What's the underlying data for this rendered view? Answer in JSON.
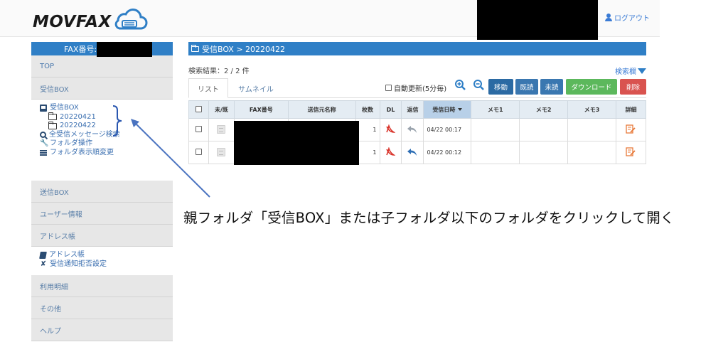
{
  "header": {
    "logo_text": "MOVFAX",
    "logout_label": "ログアウト"
  },
  "sidebar": {
    "fax_number_label": "FAX番号:",
    "nav_top": "TOP",
    "nav_inbox": "受信BOX",
    "inbox_panel": {
      "root_label": "受信BOX",
      "folders": [
        "20220421",
        "20220422"
      ],
      "search_all": "全受信メッセージ検索",
      "folder_ops": "フォルダ操作",
      "folder_order": "フォルダ表示順変更"
    },
    "nav_outbox": "送信BOX",
    "nav_userinfo": "ユーザー情報",
    "nav_addressbook": "アドレス帳",
    "address_panel": {
      "addressbook": "アドレス帳",
      "reject": "受信通知拒否設定"
    },
    "nav_usage": "利用明細",
    "nav_other": "その他",
    "nav_help": "ヘルプ"
  },
  "main": {
    "breadcrumb": "受信BOX > 20220422",
    "results": "検索結果：2 / 2 件",
    "search_toggle": "検索欄",
    "tabs": [
      "リスト",
      "サムネイル"
    ],
    "auto_update": "自動更新(5分毎)",
    "buttons": {
      "move": "移動",
      "read": "既読",
      "unread": "未読",
      "download": "ダウンロード",
      "delete": "削除"
    },
    "table": {
      "headers": [
        "",
        "未/既",
        "FAX番号",
        "送信元名称",
        "枚数",
        "DL",
        "返信",
        "受信日時",
        "メモ1",
        "メモ2",
        "メモ3",
        "詳細"
      ],
      "rows": [
        {
          "pages": "1",
          "received": "04/22 00:17"
        },
        {
          "pages": "1",
          "received": "04/22 00:12"
        }
      ]
    }
  },
  "annotation": {
    "caption": "親フォルダ「受信BOX」または子フォルダ以下のフォルダをクリックして開く"
  },
  "colors": {
    "brand_blue": "#2f7fc6",
    "btn_move": "#2b6aa3",
    "btn_read": "#3a77b0",
    "btn_unread": "#3a77b0",
    "btn_download": "#5cb85c",
    "btn_delete": "#d9534f"
  }
}
